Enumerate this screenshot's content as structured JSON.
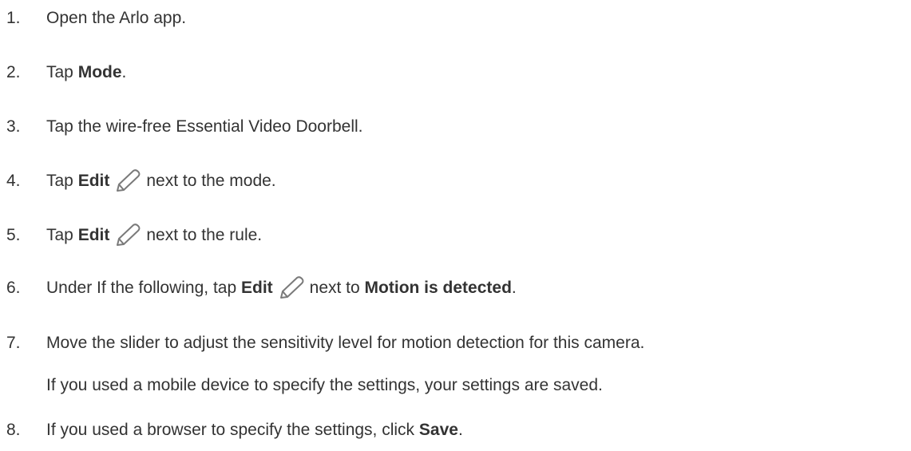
{
  "steps": [
    {
      "num": "1.",
      "text": "Open the Arlo app."
    },
    {
      "num": "2.",
      "pre": "Tap ",
      "bold": "Mode",
      "post": "."
    },
    {
      "num": "3.",
      "text": "Tap the wire-free Essential Video Doorbell."
    },
    {
      "num": "4.",
      "pre": "Tap ",
      "bold": "Edit",
      "icon": "pencil-icon",
      "post": "next to the mode."
    },
    {
      "num": "5.",
      "pre": "Tap ",
      "bold": "Edit",
      "icon": "pencil-icon",
      "post": "next to the rule."
    },
    {
      "num": "6.",
      "pre": "Under If the following, tap ",
      "bold": "Edit",
      "icon": "pencil-icon",
      "post": "next to ",
      "bold2": "Motion is detected",
      "post2": "."
    },
    {
      "num": "7.",
      "text": "Move the slider to adjust the sensitivity level for motion detection for this camera.",
      "note": "If you used a mobile device to specify the settings, your settings are saved."
    },
    {
      "num": "8.",
      "pre": "If you used a browser to specify the settings, click ",
      "bold": "Save",
      "post": "."
    }
  ],
  "colors": {
    "text": "#333333",
    "icon": "#7a7a7a"
  }
}
